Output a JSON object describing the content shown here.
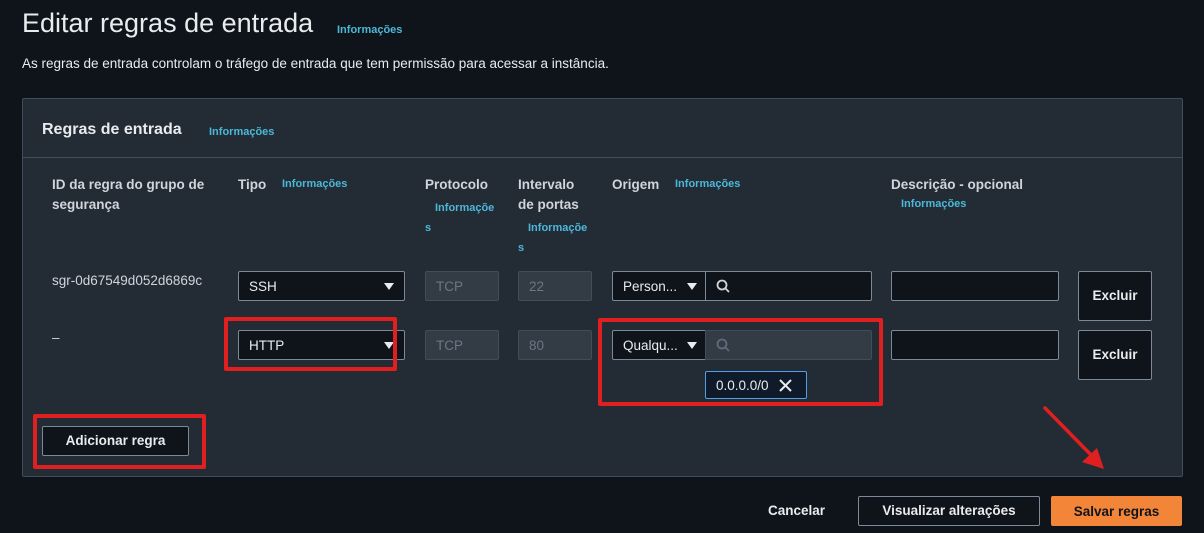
{
  "page": {
    "title": "Editar regras de entrada",
    "title_info": "Informações",
    "subtitle": "As regras de entrada controlam o tráfego de entrada que tem permissão para acessar a instância."
  },
  "panel": {
    "title": "Regras de entrada",
    "info": "Informações"
  },
  "columns": {
    "rule_id": "ID da regra do grupo de segurança",
    "type": "Tipo",
    "type_info": "Informações",
    "protocol": "Protocolo",
    "protocol_info": "Informações",
    "port_range": "Intervalo de portas",
    "port_info": "Informações",
    "source": "Origem",
    "source_info": "Informações",
    "description": "Descrição - opcional",
    "description_info": "Informações"
  },
  "rows": [
    {
      "rule_id": "sgr-0d67549d052d6869c",
      "type": "SSH",
      "protocol": "TCP",
      "port": "22",
      "source": "Person...",
      "delete_label": "Excluir"
    },
    {
      "rule_id": "–",
      "type": "HTTP",
      "protocol": "TCP",
      "port": "80",
      "source": "Qualqu...",
      "token": "0.0.0.0/0",
      "delete_label": "Excluir"
    }
  ],
  "actions": {
    "add_rule": "Adicionar regra",
    "cancel": "Cancelar",
    "preview": "Visualizar alterações",
    "save": "Salvar regras"
  },
  "colors": {
    "background": "#0f141a",
    "panel": "#232b35",
    "primary": "#f38539",
    "link": "#4cb8d8",
    "highlight": "#e02020"
  }
}
